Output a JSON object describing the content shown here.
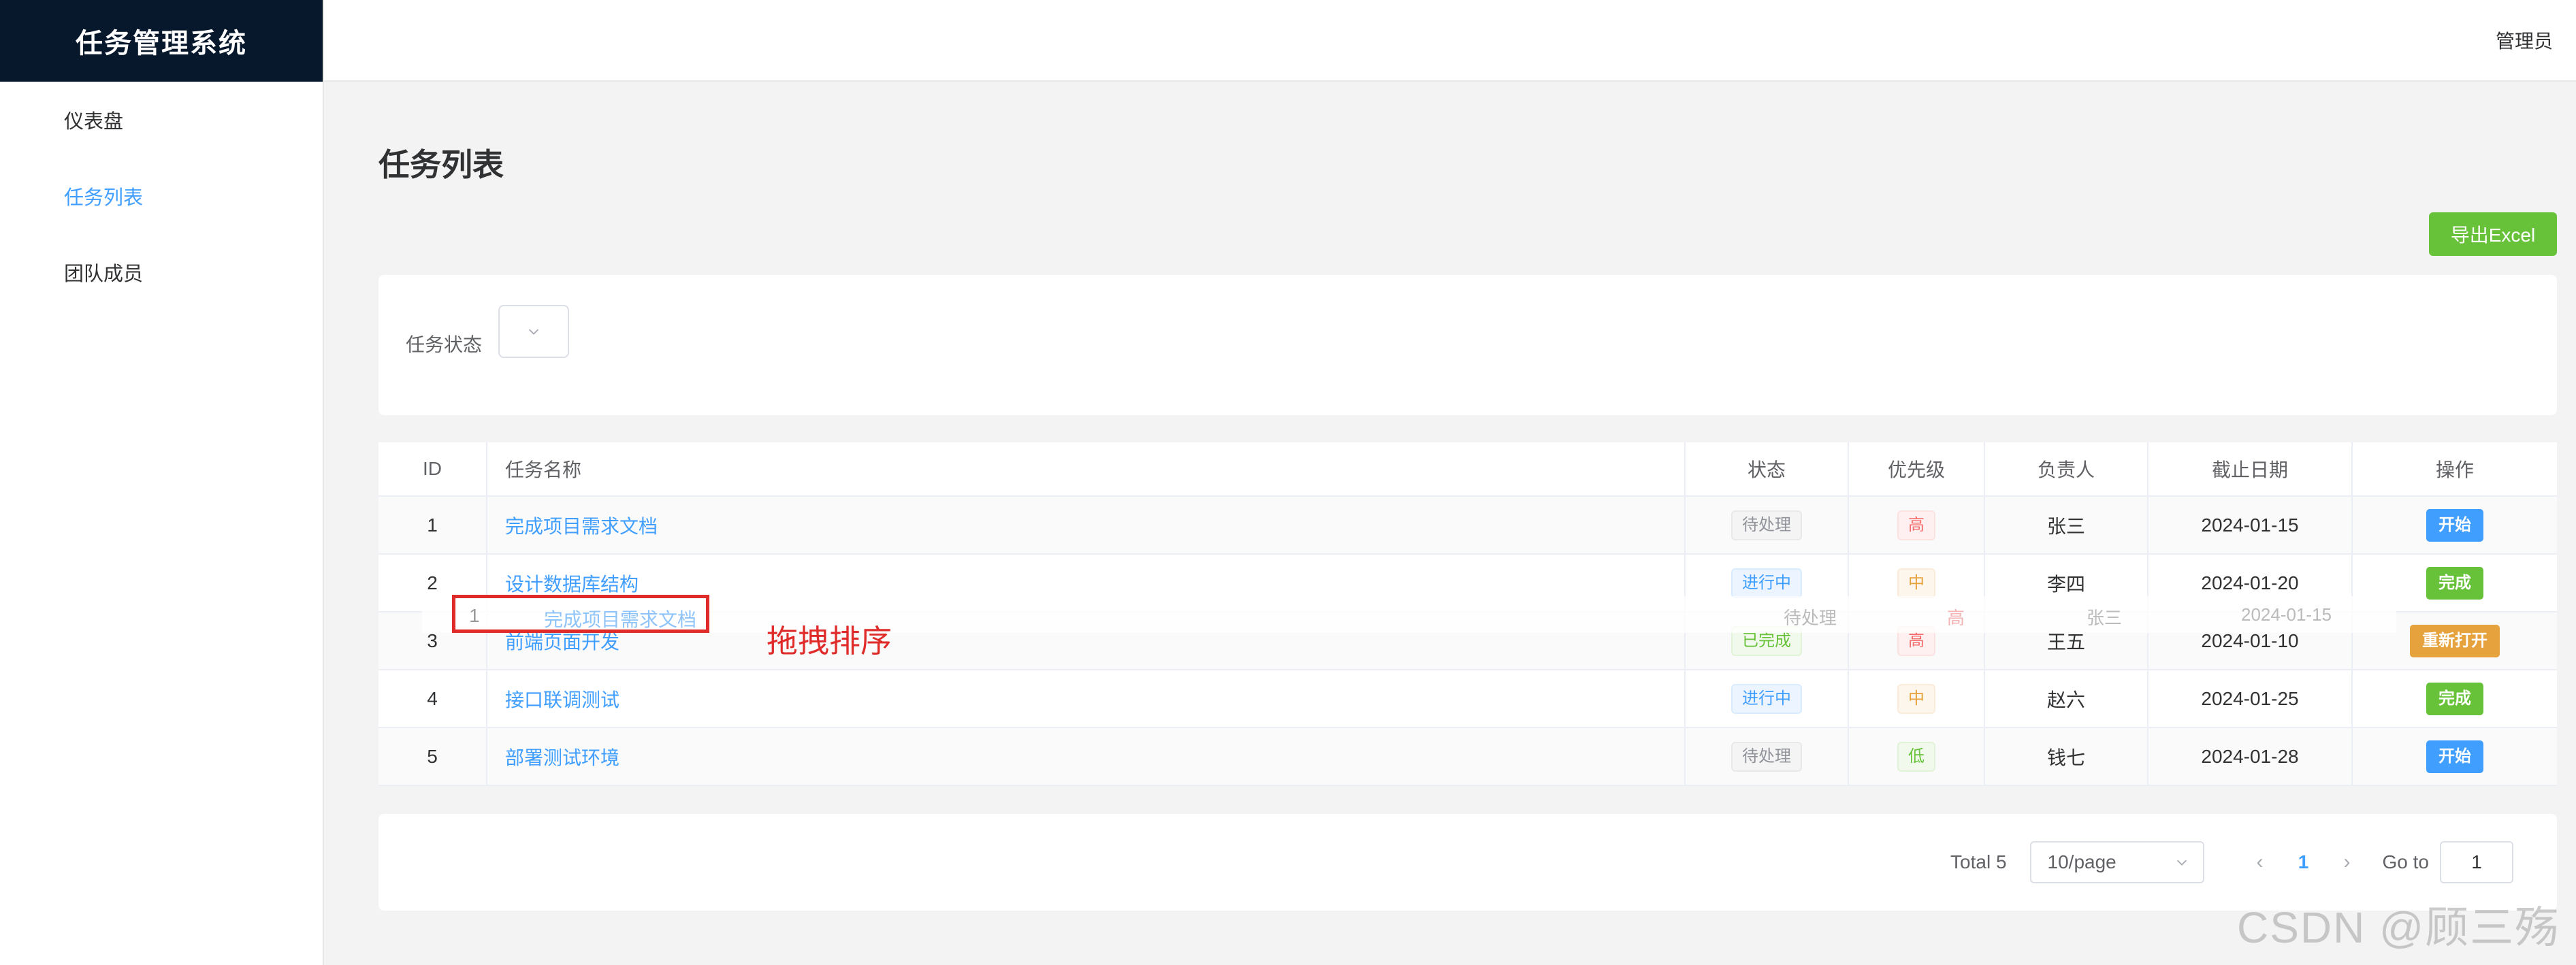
{
  "app": {
    "title": "任务管理系统",
    "user": "管理员"
  },
  "sidebar": {
    "items": [
      {
        "label": "仪表盘"
      },
      {
        "label": "任务列表"
      },
      {
        "label": "团队成员"
      }
    ]
  },
  "page": {
    "title": "任务列表",
    "export_label": "导出Excel"
  },
  "filter": {
    "label": "任务状态",
    "icon": "chevron-down-icon"
  },
  "table": {
    "headers": {
      "id": "ID",
      "name": "任务名称",
      "status": "状态",
      "priority": "优先级",
      "owner": "负责人",
      "due": "截止日期",
      "action": "操作"
    },
    "rows": [
      {
        "id": "1",
        "name": "完成项目需求文档",
        "status": "待处理",
        "priority": "高",
        "owner": "张三",
        "due": "2024-01-15",
        "action": "开始"
      },
      {
        "id": "2",
        "name": "设计数据库结构",
        "status": "进行中",
        "priority": "中",
        "owner": "李四",
        "due": "2024-01-20",
        "action": "完成"
      },
      {
        "id": "3",
        "name": "前端页面开发",
        "status": "已完成",
        "priority": "高",
        "owner": "王五",
        "due": "2024-01-10",
        "action": "重新打开"
      },
      {
        "id": "4",
        "name": "接口联调测试",
        "status": "进行中",
        "priority": "中",
        "owner": "赵六",
        "due": "2024-01-25",
        "action": "完成"
      },
      {
        "id": "5",
        "name": "部署测试环境",
        "status": "待处理",
        "priority": "低",
        "owner": "钱七",
        "due": "2024-01-28",
        "action": "开始"
      }
    ]
  },
  "drag": {
    "id": "1",
    "name": "完成项目需求文档",
    "status": "待处理",
    "priority": "高",
    "owner": "张三",
    "due": "2024-01-15",
    "note": "拖拽排序"
  },
  "pagination": {
    "total": "Total 5",
    "page_size": "10/page",
    "current": "1",
    "goto_label": "Go to",
    "goto_value": "1"
  },
  "watermark": "CSDN @顾三殇",
  "colors": {
    "primary": "#409eff",
    "success": "#67c23a",
    "warning": "#e6a23c",
    "danger": "#f56c6c",
    "sidebar_logo_bg": "#07172c"
  }
}
